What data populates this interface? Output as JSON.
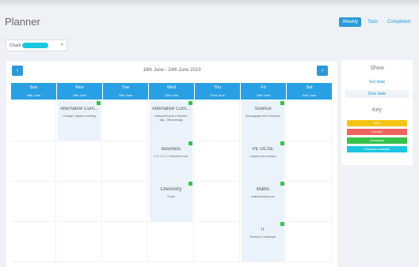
{
  "page": {
    "title": "Planner"
  },
  "tabs": [
    {
      "label": "Weekly",
      "active": true
    },
    {
      "label": "Todo"
    },
    {
      "label": "Completed"
    }
  ],
  "student": {
    "name": "Charli"
  },
  "week": {
    "range": "18th June - 24th June 2023"
  },
  "days": [
    {
      "name": "Sun",
      "date": "18th June"
    },
    {
      "name": "Mon",
      "date": "19th June"
    },
    {
      "name": "Tue",
      "date": "20th June"
    },
    {
      "name": "Wed",
      "date": "21st June"
    },
    {
      "name": "Thu",
      "date": "22nd June"
    },
    {
      "name": "Fri",
      "date": "23rd June"
    },
    {
      "name": "Sat",
      "date": "24th June"
    }
  ],
  "rows": [
    [
      null,
      {
        "subject": "Alternative Curri...",
        "desc": "College Captain meeting"
      },
      null,
      {
        "subject": "Alternative Curri...",
        "desc": "National thank a teacher day - Wednesday"
      },
      null,
      {
        "subject": "Science",
        "desc": "Belongings left in Science"
      },
      null
    ],
    [
      null,
      null,
      null,
      {
        "subject": "Business",
        "desc": "1.1/ 1.2/ 1.3 Revision test"
      },
      null,
      {
        "subject": "PE GCSE",
        "desc": "Copied test revision"
      },
      null
    ],
    [
      null,
      null,
      null,
      {
        "subject": "Chemistry",
        "desc": "Fuels"
      },
      null,
      {
        "subject": "Maths",
        "desc": "mathsmoney.com"
      },
      null
    ],
    [
      null,
      null,
      null,
      null,
      null,
      {
        "subject": "IT",
        "desc": "Revision Challenge"
      },
      null
    ]
  ],
  "sidebar": {
    "show_heading": "Show",
    "set_date": "Set date",
    "due_date": "Due date",
    "key_heading": "Key",
    "legend": [
      {
        "label": "Due",
        "color": "#f4c414"
      },
      {
        "label": "Overdue",
        "color": "#f0645f"
      },
      {
        "label": "Completed",
        "color": "#35c24a"
      },
      {
        "label": "Feedback available",
        "color": "#1cc6e2"
      }
    ]
  },
  "colors": {
    "accent": "#2a9ad9",
    "card_bg": "#eaf3fb"
  }
}
